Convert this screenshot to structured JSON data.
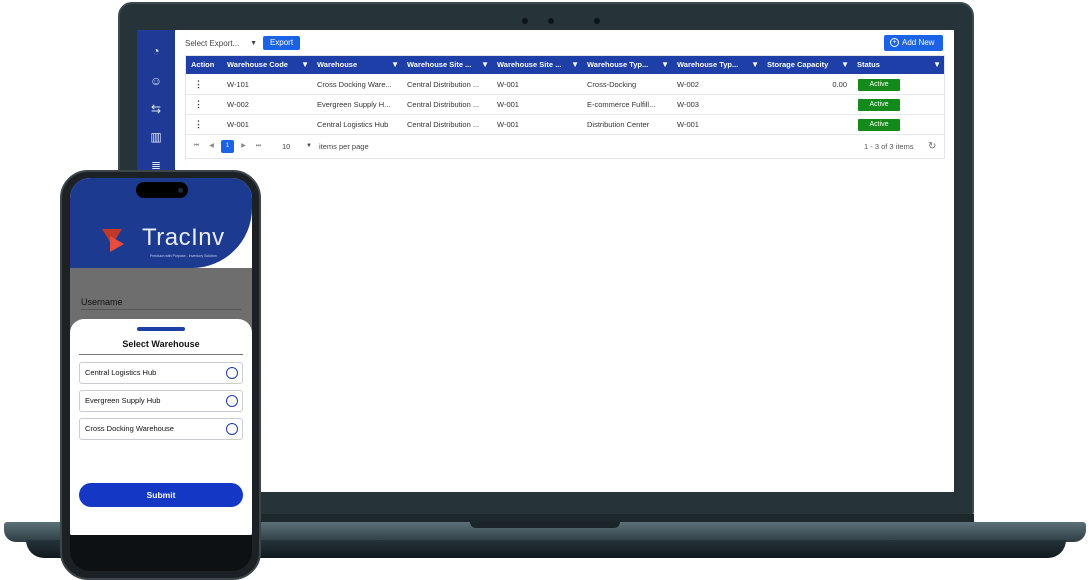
{
  "web_app": {
    "sidebar_icons": [
      "dashboard-icon",
      "user-circle-icon",
      "transfer-icon",
      "barcode-icon",
      "database-icon"
    ],
    "toolbar": {
      "export_select_label": "Select Export...",
      "export_button_label": "Export",
      "add_new_label": "Add New"
    },
    "table": {
      "columns": [
        "Action",
        "Warehouse Code",
        "Warehouse",
        "Warehouse Site ...",
        "Warehouse Site ...",
        "Warehouse Typ...",
        "Warehouse Typ...",
        "Storage Capacity",
        "Status"
      ],
      "rows": [
        {
          "code": "W-101",
          "warehouse": "Cross Docking Ware...",
          "site_name": "Central Distribution ...",
          "site_code": "W-001",
          "type_name": "Cross-Docking",
          "type_code": "W-002",
          "capacity": "0.00",
          "status": "Active"
        },
        {
          "code": "W-002",
          "warehouse": "Evergreen Supply H...",
          "site_name": "Central Distribution ...",
          "site_code": "W-001",
          "type_name": "E-commerce Fulfill...",
          "type_code": "W-003",
          "capacity": "",
          "status": "Active"
        },
        {
          "code": "W-001",
          "warehouse": "Central Logistics Hub",
          "site_name": "Central Distribution ...",
          "site_code": "W-001",
          "type_name": "Distribution Center",
          "type_code": "W-001",
          "capacity": "",
          "status": "Active"
        }
      ],
      "status_color": "#138a1a"
    },
    "pager": {
      "current_page": "1",
      "page_size": "10",
      "items_per_page_label": "items per page",
      "info": "1 - 3 of 3 items"
    },
    "accent_color": "#1a63e6",
    "sidebar_color": "#1e3a96"
  },
  "mobile_app": {
    "brand": "TracInv",
    "tagline": "Precision with Purpose - Inventory Solution",
    "username_label": "Username",
    "sheet_title": "Select Warehouse",
    "options": [
      "Central Logistics Hub",
      "Evergreen Supply Hub",
      "Cross Docking Warehouse"
    ],
    "submit_label": "Submit",
    "primary_color": "#1537c6"
  }
}
